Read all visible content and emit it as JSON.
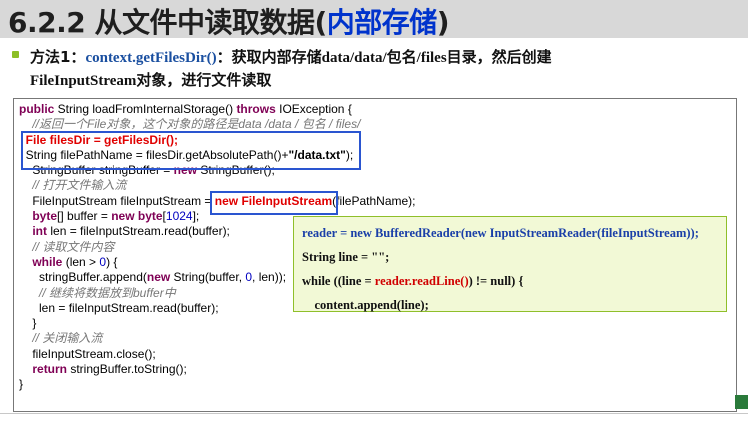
{
  "title": {
    "number": "6.2.2 ",
    "text": "从文件中读取数据(",
    "highlight": "内部存储",
    "close": ")"
  },
  "bullet": {
    "prefix": "方法1：",
    "method": "context.getFilesDir()",
    "middle": "：获取内部存储",
    "path": "data/data/包名/files",
    "suffix": "目录，然后创建",
    "line2a": "FileInputStream",
    "line2b": "对象，进行文件读取"
  },
  "code": {
    "l1a": "public",
    "l1b": " String loadFromInternalStorage() ",
    "l1c": "throws",
    "l1d": " IOException {",
    "l2": "    //返回一个File对象，这个对象的路径是data /data / 包名 / files/",
    "l3": "  File filesDir = getFilesDir();",
    "l4a": "  String filePathName = filesDir.getAbsolutePath()+",
    "l4b": "\"/data.txt\"",
    "l4c": ");",
    "l5a": "    StringBuffer stringBuffer = ",
    "l5b": "new",
    "l5c": " StringBuffer();",
    "l6": "    // 打开文件输入流",
    "l7a": "    FileInputStream fileInputStream = ",
    "l7b": "new FileInputStream",
    "l7c": "(filePathName);",
    "l8a": "byte",
    "l8b": "[] buffer = ",
    "l8c": "new",
    "l8d": " byte",
    "l8e": "[",
    "l8f": "1024",
    "l8g": "];",
    "l9a": "int",
    "l9b": " len = fileInputStream.read(buffer);",
    "l10": "    // 读取文件内容",
    "l11a": "while",
    "l11b": " (len > ",
    "l11c": "0",
    "l11d": ") {",
    "l12a": "      stringBuffer.append(",
    "l12b": "new",
    "l12c": " String(buffer, ",
    "l12d": "0",
    "l12e": ", len));",
    "l13": "      // 继续将数据放到buffer中",
    "l14": "      len = fileInputStream.read(buffer);",
    "l15": "    }",
    "l16": "    // 关闭输入流",
    "l17": "    fileInputStream.close();",
    "l18a": "return",
    "l18b": " stringBuffer.toString();",
    "l19": "}"
  },
  "tip": {
    "t1": "reader = new BufferedReader(new InputStreamReader(fileInputStream));",
    "t2": "String line = \"\";",
    "t3a": "while ((line = ",
    "t3b": "reader.readLine()",
    "t3c": ") != null) {",
    "t4": "    content.append(line);"
  }
}
